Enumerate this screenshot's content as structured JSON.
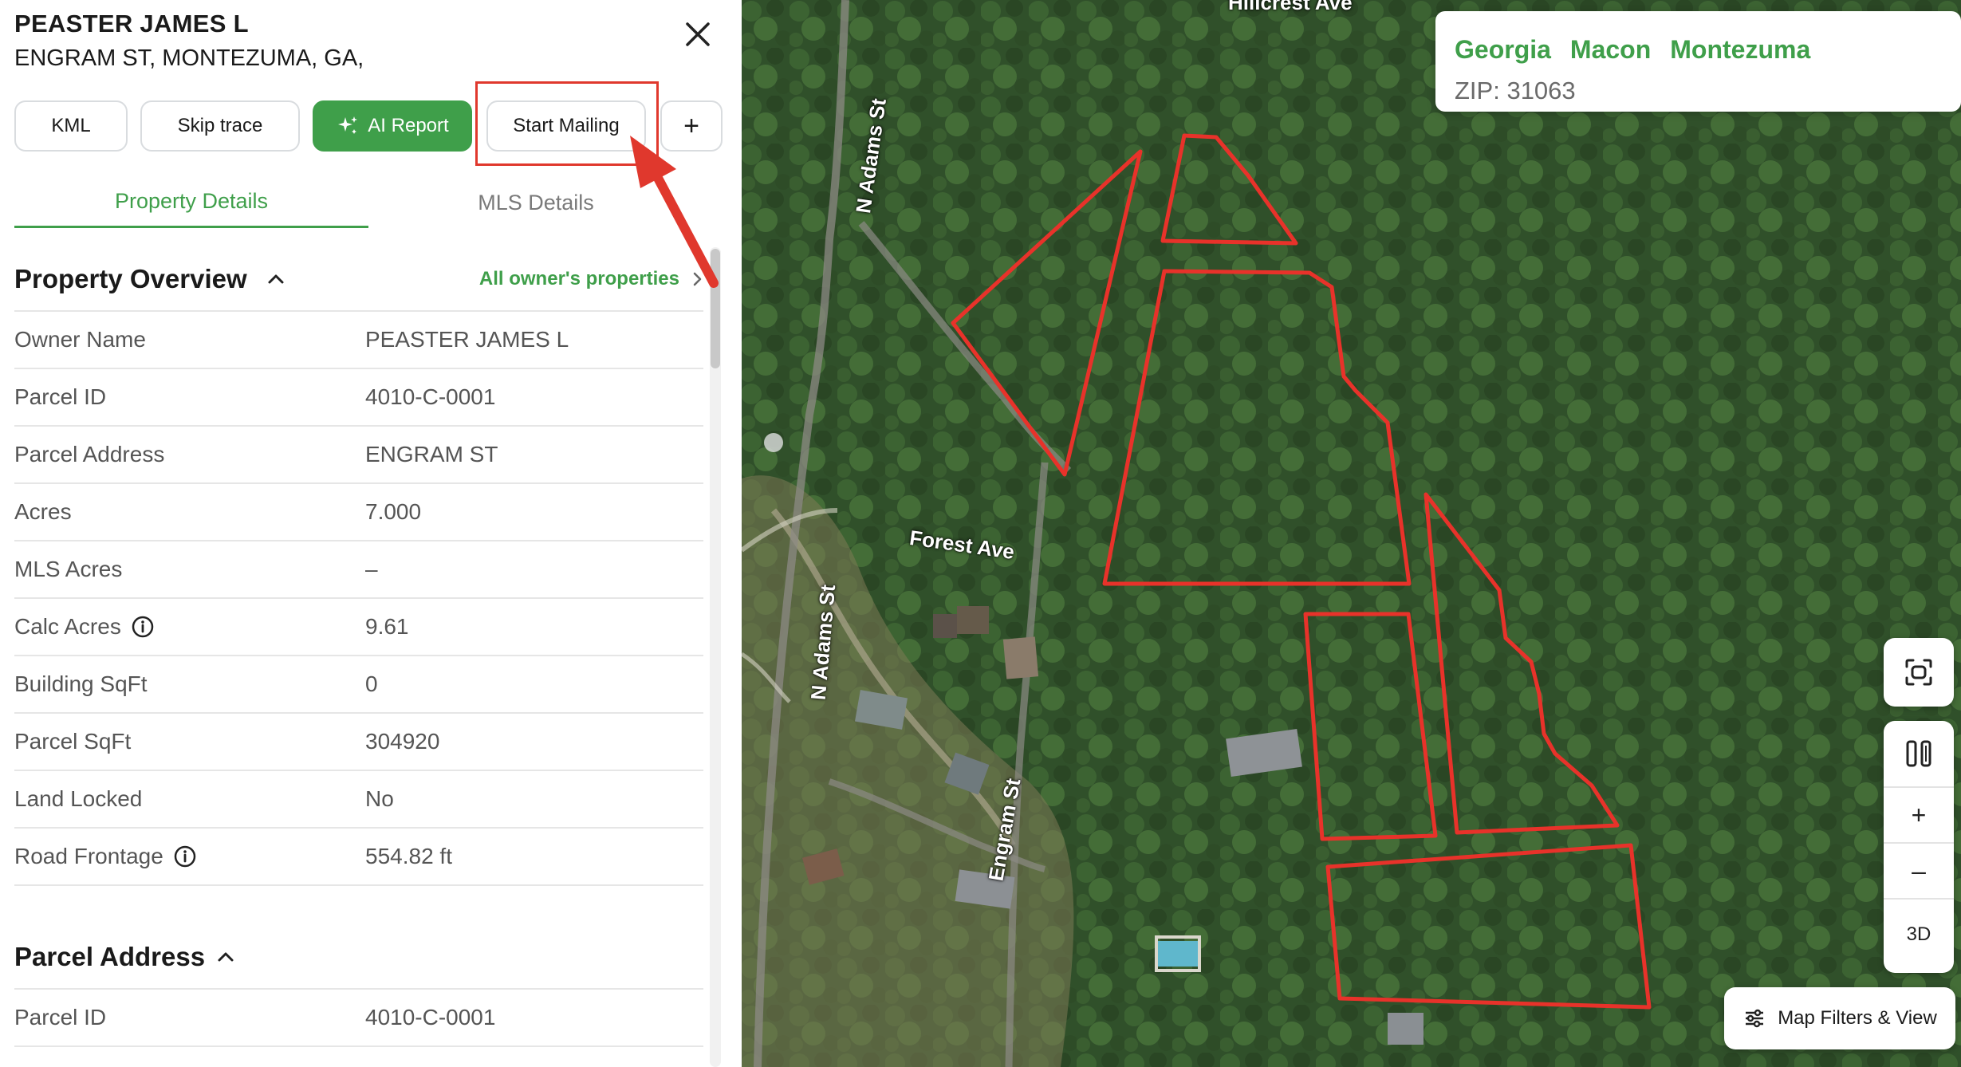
{
  "header": {
    "owner_name": "PEASTER JAMES L",
    "address": "ENGRAM ST, MONTEZUMA, GA,"
  },
  "actions": {
    "kml": "KML",
    "skip_trace": "Skip trace",
    "ai_report": "AI Report",
    "start_mailing": "Start Mailing",
    "more": "+"
  },
  "tabs": [
    {
      "label": "Property Details",
      "active": true
    },
    {
      "label": "MLS Details",
      "active": false
    }
  ],
  "overview": {
    "title": "Property Overview",
    "owner_link": "All owner's properties",
    "rows": [
      {
        "label": "Owner Name",
        "value": "PEASTER JAMES L"
      },
      {
        "label": "Parcel ID",
        "value": "4010-C-0001"
      },
      {
        "label": "Parcel Address",
        "value": "ENGRAM ST"
      },
      {
        "label": "Acres",
        "value": "7.000"
      },
      {
        "label": "MLS Acres",
        "value": "–"
      },
      {
        "label": "Calc Acres",
        "value": "9.61"
      },
      {
        "label": "Building SqFt",
        "value": "0"
      },
      {
        "label": "Parcel SqFt",
        "value": "304920"
      },
      {
        "label": "Land Locked",
        "value": "No"
      },
      {
        "label": "Road Frontage",
        "value": "554.82 ft"
      }
    ]
  },
  "parcel_address": {
    "title": "Parcel Address",
    "rows": [
      {
        "label": "Parcel ID",
        "value": "4010-C-0001"
      }
    ]
  },
  "map": {
    "location": {
      "state": "Georgia",
      "county": "Macon",
      "city": "Montezuma",
      "zip": "ZIP: 31063"
    },
    "streets": {
      "hillcrest": "Hillcrest Ave",
      "adams_top": "N Adams St",
      "adams_bottom": "N Adams St",
      "forest": "Forest Ave",
      "engram": "Engram St"
    },
    "controls": {
      "zoom_in": "+",
      "zoom_out": "–",
      "three_d": "3D"
    },
    "filters_label": "Map Filters & View"
  },
  "colors": {
    "accent": "#3f9f4a",
    "annotation": "#e0382d",
    "parcel_outline": "#e8322a"
  }
}
